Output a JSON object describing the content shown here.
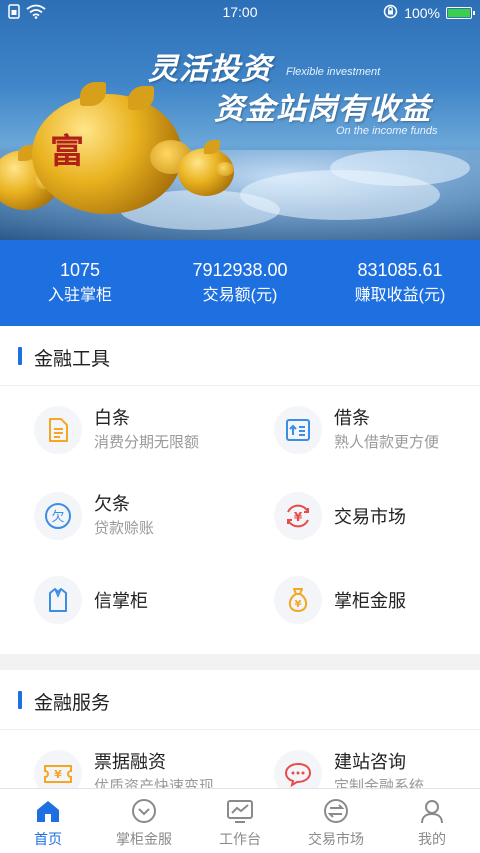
{
  "status_bar": {
    "time": "17:00",
    "battery": "100%"
  },
  "banner": {
    "title_line1": "灵活投资",
    "subtitle_line1": "Flexible investment",
    "title_line2": "资金站岗有收益",
    "subtitle_line2": "On the income funds",
    "pig_mark": "富"
  },
  "stats": [
    {
      "value": "1075",
      "label": "入驻掌柜"
    },
    {
      "value": "7912938.00",
      "label": "交易额(元)"
    },
    {
      "value": "831085.61",
      "label": "赚取收益(元)"
    }
  ],
  "financial_tools": {
    "title": "金融工具",
    "items": [
      {
        "name": "白条",
        "desc": "消费分期无限额",
        "icon": "document-icon"
      },
      {
        "name": "借条",
        "desc": "熟人借款更方便",
        "icon": "list-upload-icon"
      },
      {
        "name": "欠条",
        "desc": "贷款赊账",
        "icon": "iou-icon",
        "glyph": "欠"
      },
      {
        "name": "交易市场",
        "desc": "",
        "icon": "yuan-exchange-icon",
        "glyph": "¥"
      },
      {
        "name": "信掌柜",
        "desc": "",
        "icon": "shirt-icon"
      },
      {
        "name": "掌柜金服",
        "desc": "",
        "icon": "money-bag-icon",
        "glyph": "¥"
      }
    ]
  },
  "financial_services": {
    "title": "金融服务",
    "items": [
      {
        "name": "票据融资",
        "desc": "优质资产快速变现",
        "icon": "ticket-icon",
        "glyph": "¥"
      },
      {
        "name": "建站咨询",
        "desc": "定制金融系统",
        "icon": "chat-bubble-icon"
      }
    ]
  },
  "tabbar": {
    "items": [
      {
        "label": "首页",
        "icon": "home-icon",
        "active": true
      },
      {
        "label": "掌柜金服",
        "icon": "chevron-circle-icon",
        "active": false
      },
      {
        "label": "工作台",
        "icon": "chart-monitor-icon",
        "active": false
      },
      {
        "label": "交易市场",
        "icon": "exchange-circle-icon",
        "active": false
      },
      {
        "label": "我的",
        "icon": "user-icon",
        "active": false
      }
    ]
  },
  "colors": {
    "primary": "#1e6fe0",
    "orange": "#f5a623",
    "red": "#e94b4b",
    "blue_icon": "#3a8ee6",
    "battery_green": "#3ccf4e"
  }
}
